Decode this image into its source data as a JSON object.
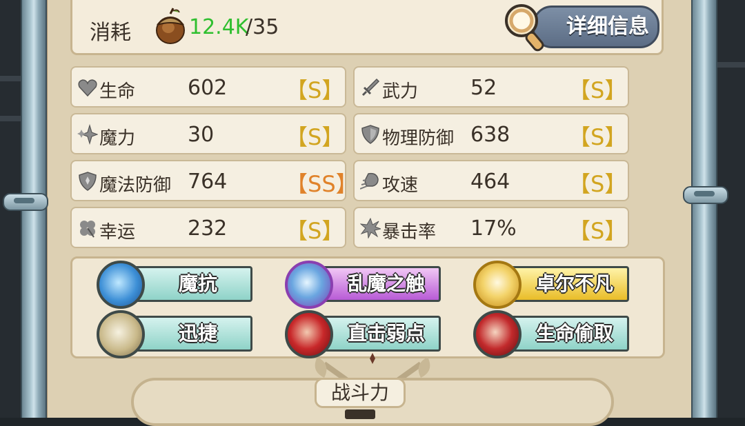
{
  "cost": {
    "label": "消耗",
    "have": "12.4K",
    "slash": "/",
    "need": "35"
  },
  "detail_button": {
    "label": "详细信息"
  },
  "stats": [
    {
      "name": "生命",
      "value": "602",
      "grade": "【S】",
      "icon": "heart-icon"
    },
    {
      "name": "武力",
      "value": "52",
      "grade": "【S】",
      "icon": "sword-icon"
    },
    {
      "name": "魔力",
      "value": "30",
      "grade": "【S】",
      "icon": "sparkle-icon"
    },
    {
      "name": "物理防御",
      "value": "638",
      "grade": "【S】",
      "icon": "shield-icon"
    },
    {
      "name": "魔法防御",
      "value": "764",
      "grade": "【SS】",
      "icon": "magic-shield-icon"
    },
    {
      "name": "攻速",
      "value": "464",
      "grade": "【S】",
      "icon": "speed-fist-icon"
    },
    {
      "name": "幸运",
      "value": "232",
      "grade": "【S】",
      "icon": "clover-icon"
    },
    {
      "name": "暴击率",
      "value": "17%",
      "grade": "【S】",
      "icon": "burst-icon"
    }
  ],
  "skills": [
    {
      "label": "魔抗",
      "style": "teal",
      "icon": "magic-resist-icon"
    },
    {
      "label": "乱魔之触",
      "style": "purple",
      "icon": "chaos-touch-icon"
    },
    {
      "label": "卓尔不凡",
      "style": "gold",
      "icon": "extraordinary-icon"
    },
    {
      "label": "迅捷",
      "style": "teal",
      "icon": "swift-icon"
    },
    {
      "label": "直击弱点",
      "style": "teal",
      "icon": "weak-point-icon"
    },
    {
      "label": "生命偷取",
      "style": "teal",
      "icon": "life-steal-icon"
    }
  ],
  "combat_power": {
    "label": "战斗力"
  },
  "colors": {
    "have_amount": "#2fbf2f",
    "grade_s": "#d2a520",
    "grade_ss": "#e0822a"
  }
}
